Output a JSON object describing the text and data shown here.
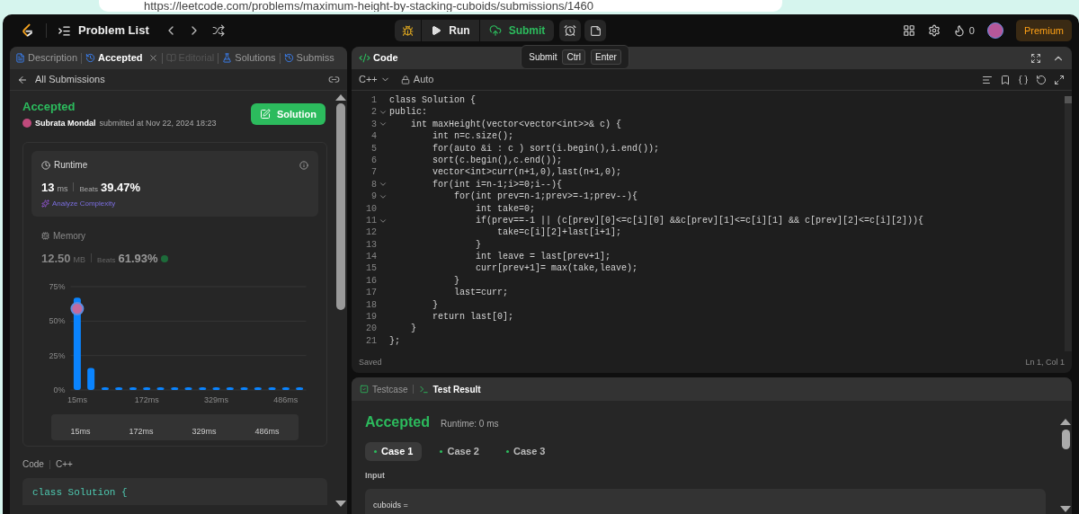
{
  "browser": {
    "url": "https://leetcode.com/problems/maximum-height-by-stacking-cuboids/submissions/1460"
  },
  "nav": {
    "problem_list": "Problem List",
    "run": "Run",
    "submit": "Submit",
    "tooltip": {
      "label": "Submit",
      "keys": [
        "Ctrl",
        "Enter"
      ]
    },
    "streak": "0",
    "premium": "Premium"
  },
  "left": {
    "tabs": [
      {
        "label": "Description",
        "selected": false,
        "disabled": false,
        "closable": false
      },
      {
        "label": "Accepted",
        "selected": true,
        "disabled": false,
        "closable": true
      },
      {
        "label": "Editorial",
        "selected": false,
        "disabled": true,
        "closable": false
      },
      {
        "label": "Solutions",
        "selected": false,
        "disabled": false,
        "closable": false
      },
      {
        "label": "Submiss",
        "selected": false,
        "disabled": false,
        "closable": false
      }
    ],
    "back": "All Submissions",
    "status": "Accepted",
    "user": "Subrata Mondal",
    "submitted": "submitted at Nov 22, 2024 18:23",
    "solution_button": "Solution",
    "runtime": {
      "title": "Runtime",
      "value": "13",
      "unit": "ms",
      "beats_label": "Beats",
      "beats": "39.47%",
      "analyze": "Analyze Complexity"
    },
    "memory": {
      "title": "Memory",
      "value": "12.50",
      "unit": "MB",
      "beats_label": "Beats",
      "beats": "61.93%"
    },
    "chart_data": {
      "type": "bar",
      "x": [
        15,
        46,
        78,
        109,
        141,
        172,
        203,
        235,
        266,
        298,
        329,
        360,
        392,
        423,
        455,
        486,
        517
      ],
      "xlim": [
        0,
        532
      ],
      "series": [
        {
          "color": "#0a84ff",
          "values": [
            67,
            16,
            2,
            2,
            2,
            2,
            2,
            2,
            2,
            2,
            2,
            2,
            2,
            2,
            2,
            2,
            2
          ]
        }
      ],
      "ylim": [
        0,
        75
      ],
      "yticks": [
        {
          "value": 0,
          "label": "0%"
        },
        {
          "value": 25,
          "label": "25%"
        },
        {
          "value": 50,
          "label": "50%"
        },
        {
          "value": 75,
          "label": "75%"
        }
      ],
      "xticks": [
        {
          "value": 15,
          "label": "15ms"
        },
        {
          "value": 172,
          "label": "172ms"
        },
        {
          "value": 329,
          "label": "329ms"
        },
        {
          "value": 486,
          "label": "486ms"
        }
      ]
    },
    "brush_labels": [
      "15ms",
      "172ms",
      "329ms",
      "486ms"
    ],
    "code_title": "Code",
    "code_lang": "C++",
    "code_preview": "class Solution {"
  },
  "editor": {
    "title": "Code",
    "language": "C++",
    "mode": "Auto",
    "lines": [
      {
        "no": "1",
        "text": "class Solution {",
        "fold": false
      },
      {
        "no": "2",
        "text": "public:",
        "fold": true
      },
      {
        "no": "3",
        "text": "    int maxHeight(vector<vector<int>>& c) {",
        "fold": true
      },
      {
        "no": "4",
        "text": "        int n=c.size();",
        "fold": false
      },
      {
        "no": "5",
        "text": "        for(auto &i : c ) sort(i.begin(),i.end());",
        "fold": false
      },
      {
        "no": "6",
        "text": "        sort(c.begin(),c.end());",
        "fold": false
      },
      {
        "no": "7",
        "text": "        vector<int>curr(n+1,0),last(n+1,0);",
        "fold": false
      },
      {
        "no": "8",
        "text": "        for(int i=n-1;i>=0;i--){",
        "fold": true
      },
      {
        "no": "9",
        "text": "            for(int prev=n-1;prev>=-1;prev--){",
        "fold": true
      },
      {
        "no": "10",
        "text": "                int take=0;",
        "fold": false
      },
      {
        "no": "11",
        "text": "                if(prev==-1 || (c[prev][0]<=c[i][0] &&c[prev][1]<=c[i][1] && c[prev][2]<=c[i][2])){",
        "fold": true
      },
      {
        "no": "12",
        "text": "                    take=c[i][2]+last[i+1];",
        "fold": false
      },
      {
        "no": "13",
        "text": "                }",
        "fold": false
      },
      {
        "no": "14",
        "text": "                int leave = last[prev+1];",
        "fold": false
      },
      {
        "no": "15",
        "text": "                curr[prev+1]= max(take,leave);",
        "fold": false
      },
      {
        "no": "16",
        "text": "            }",
        "fold": false
      },
      {
        "no": "17",
        "text": "            last=curr;",
        "fold": false
      },
      {
        "no": "18",
        "text": "        }",
        "fold": false
      },
      {
        "no": "19",
        "text": "        return last[0];",
        "fold": false
      },
      {
        "no": "20",
        "text": "    }",
        "fold": false
      },
      {
        "no": "21",
        "text": "};",
        "fold": false
      }
    ],
    "status": "Saved",
    "cursor": "Ln 1, Col 1"
  },
  "test": {
    "tabs": [
      {
        "label": "Testcase",
        "selected": false
      },
      {
        "label": "Test Result",
        "selected": true
      }
    ],
    "verdict": "Accepted",
    "runtime": "Runtime: 0 ms",
    "cases": [
      {
        "label": "Case 1",
        "selected": true
      },
      {
        "label": "Case 2",
        "selected": false
      },
      {
        "label": "Case 3",
        "selected": false
      }
    ],
    "input_label": "Input",
    "input_var": "cuboids ="
  }
}
